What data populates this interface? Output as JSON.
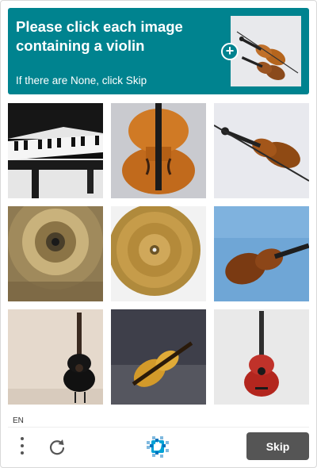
{
  "challenge": {
    "title": "Please click each image containing a violin",
    "subtitle": "If there are None, click Skip",
    "example_image": "violin-pair-example",
    "header_color": "#00838f"
  },
  "tiles": [
    {
      "content": "grand-piano-keys"
    },
    {
      "content": "violin-body-closeup-blurred"
    },
    {
      "content": "violin-with-bow"
    },
    {
      "content": "cymbal-motion-blur"
    },
    {
      "content": "cymbal"
    },
    {
      "content": "violin-on-blue"
    },
    {
      "content": "acoustic-guitar-black"
    },
    {
      "content": "violin-blurred-dark"
    },
    {
      "content": "acoustic-guitar-red"
    }
  ],
  "footer": {
    "language": "EN",
    "menu_icon": "more-vertical-icon",
    "refresh_icon": "refresh-icon",
    "logo_icon": "hcaptcha-logo-icon",
    "skip_label": "Skip",
    "skip_color": "#555555"
  }
}
